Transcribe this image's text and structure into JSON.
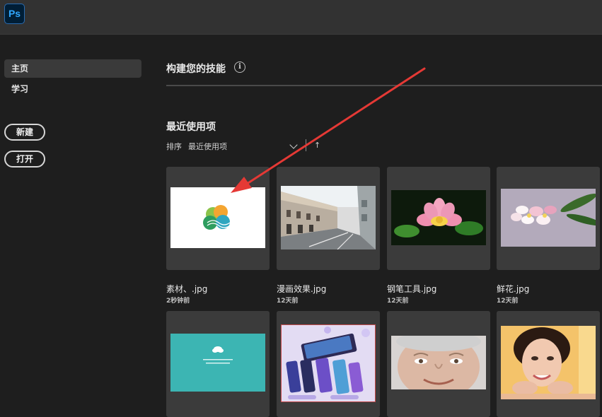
{
  "app": {
    "logo_text": "Ps",
    "brand_color": "#31a8ff"
  },
  "sidebar": {
    "items": [
      {
        "label": "主页",
        "active": true
      },
      {
        "label": "学习",
        "active": false
      }
    ],
    "new_button": "新建",
    "open_button": "打开"
  },
  "main": {
    "build_skills_title": "构建您的技能",
    "info_icon_glyph": "i",
    "recent_title": "最近使用项",
    "sort_label": "排序",
    "sort_value": "最近使用项",
    "sort_direction_glyph": "↑"
  },
  "recent_files": [
    {
      "name": "素材、.jpg",
      "time": "2秒钟前",
      "thumb": "logo-circles"
    },
    {
      "name": "漫画效果.jpg",
      "time": "12天前",
      "thumb": "street"
    },
    {
      "name": "钢笔工具.jpg",
      "time": "12天前",
      "thumb": "lotus"
    },
    {
      "name": "鲜花.jpg",
      "time": "12天前",
      "thumb": "plumeria"
    },
    {
      "name": "",
      "time": "",
      "thumb": "teal-cloud"
    },
    {
      "name": "",
      "time": "",
      "thumb": "phones"
    },
    {
      "name": "",
      "time": "",
      "thumb": "elder-face"
    },
    {
      "name": "",
      "time": "",
      "thumb": "woman-portrait"
    }
  ],
  "annotation": {
    "arrow_color": "#e53935"
  }
}
